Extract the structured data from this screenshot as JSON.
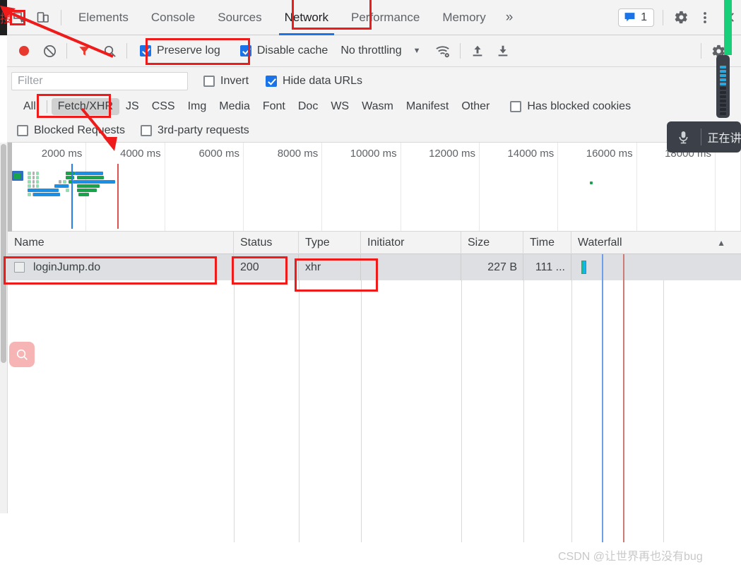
{
  "window": {
    "tabs": [
      {
        "label": "Elements",
        "active": false
      },
      {
        "label": "Console",
        "active": false
      },
      {
        "label": "Sources",
        "active": false
      },
      {
        "label": "Network",
        "active": true
      },
      {
        "label": "Performance",
        "active": false
      },
      {
        "label": "Memory",
        "active": false
      }
    ],
    "more_label": "»",
    "issues_count": "1",
    "icons": {
      "inspect": "inspect-element-icon",
      "device": "device-toolbar-icon",
      "issues": "issues-message-icon",
      "settings": "gear-icon",
      "kebab": "more-options-icon",
      "close": "close-icon"
    }
  },
  "toolbar": {
    "record_title": "record-button",
    "clear_title": "clear-button",
    "filter_title": "filter-funnel-icon",
    "search_title": "search-icon",
    "preserve_log": {
      "label": "Preserve log",
      "checked": true
    },
    "disable_cache": {
      "label": "Disable cache",
      "checked": true
    },
    "throttling": "No throttling",
    "caret": "▼",
    "wifi_title": "network-conditions-icon",
    "import_title": "import-har-icon",
    "export_title": "export-har-icon",
    "settings_title": "network-settings-gear-icon"
  },
  "filter": {
    "placeholder": "Filter",
    "value": "",
    "invert": {
      "label": "Invert",
      "checked": false
    },
    "hide_data_urls": {
      "label": "Hide data URLs",
      "checked": true
    },
    "types": [
      {
        "label": "All",
        "selected": false
      },
      {
        "label": "Fetch/XHR",
        "selected": true
      },
      {
        "label": "JS",
        "selected": false
      },
      {
        "label": "CSS",
        "selected": false
      },
      {
        "label": "Img",
        "selected": false
      },
      {
        "label": "Media",
        "selected": false
      },
      {
        "label": "Font",
        "selected": false
      },
      {
        "label": "Doc",
        "selected": false
      },
      {
        "label": "WS",
        "selected": false
      },
      {
        "label": "Wasm",
        "selected": false
      },
      {
        "label": "Manifest",
        "selected": false
      },
      {
        "label": "Other",
        "selected": false
      }
    ],
    "has_blocked_cookies": {
      "label": "Has blocked cookies",
      "checked": false
    },
    "blocked_requests": {
      "label": "Blocked Requests",
      "checked": false
    },
    "third_party": {
      "label": "3rd-party requests",
      "checked": false
    }
  },
  "overview": {
    "ticks": [
      "2000 ms",
      "4000 ms",
      "6000 ms",
      "8000 ms",
      "10000 ms",
      "12000 ms",
      "14000 ms",
      "16000 ms",
      "18000 ms"
    ]
  },
  "table": {
    "columns": [
      "Name",
      "Status",
      "Type",
      "Initiator",
      "Size",
      "Time",
      "Waterfall"
    ],
    "sort_indicator": "▲",
    "rows": [
      {
        "name": "loginJump.do",
        "status": "200",
        "type": "xhr",
        "initiator": "",
        "size": "227 B",
        "time": "111 ..."
      }
    ]
  },
  "voice": {
    "text": "正在讲",
    "mic_icon": "microphone-icon"
  },
  "overlay": {
    "pink_search_icon": "search-icon"
  },
  "watermark": "CSDN @让世界再也没有bug",
  "colors": {
    "accent": "#1a73e8",
    "record": "#e8392e",
    "annotation": "#ef1b1b",
    "green_strip": "#17cf79",
    "voice_bg": "#3c4149"
  }
}
